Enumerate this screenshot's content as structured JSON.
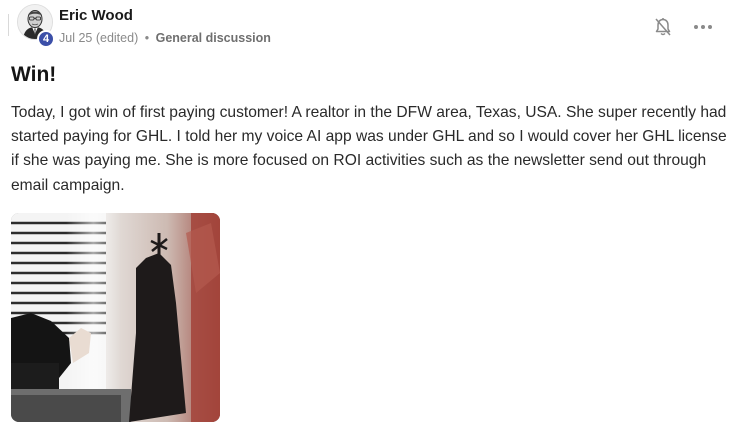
{
  "post": {
    "author_name": "Eric Wood",
    "level": "4",
    "date": "Jul 25",
    "edited": "(edited)",
    "separator": "•",
    "category": "General discussion",
    "title": "Win!",
    "body": "Today, I got win of first paying customer! A realtor in the DFW area, Texas, USA. She super recently had started paying for GHL. I told her my voice AI app was under GHL and so I would cover her GHL license if she was paying me. She is more focused on ROI activities such as the newsletter send out through email campaign."
  },
  "icons": {
    "notification": "bell-off-icon",
    "menu": "more-horizontal-icon"
  },
  "colors": {
    "level_badge": "#3b4fa8",
    "meta_text": "#8a8a8a",
    "title_text": "#151515"
  }
}
